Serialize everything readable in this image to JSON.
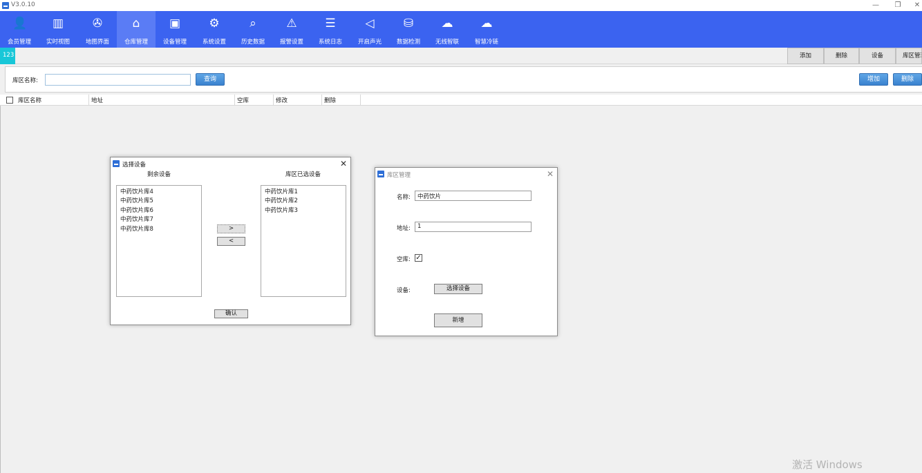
{
  "window": {
    "title": "V3.0.10",
    "minimize_glyph": "—",
    "restore_glyph": "❐",
    "close_glyph": "✕"
  },
  "toolbar": {
    "items": [
      {
        "label": "会员管理",
        "icon": "member-icon",
        "glyph": "👤"
      },
      {
        "label": "实时视图",
        "icon": "bars-icon",
        "glyph": "▥"
      },
      {
        "label": "地图界面",
        "icon": "map-icon",
        "glyph": "✇"
      },
      {
        "label": "仓库管理",
        "icon": "warehouse-icon",
        "glyph": "⌂",
        "active": true
      },
      {
        "label": "设备管理",
        "icon": "device-icon",
        "glyph": "▣"
      },
      {
        "label": "系统设置",
        "icon": "gear-icon",
        "glyph": "⚙"
      },
      {
        "label": "历史数据",
        "icon": "history-search-icon",
        "glyph": "⌕"
      },
      {
        "label": "报警设置",
        "icon": "alarm-icon",
        "glyph": "⚠"
      },
      {
        "label": "系统日志",
        "icon": "list-icon",
        "glyph": "☰"
      },
      {
        "label": "开启声光",
        "icon": "speaker-icon",
        "glyph": "◁"
      },
      {
        "label": "数据检测",
        "icon": "database-icon",
        "glyph": "⛁"
      },
      {
        "label": "无线智联",
        "icon": "cloud-icon",
        "glyph": "☁"
      },
      {
        "label": "智慧冷链",
        "icon": "cloud-icon",
        "glyph": "☁"
      }
    ]
  },
  "tabs": {
    "active_label": "123"
  },
  "top_buttons": [
    "添加",
    "删除",
    "设备",
    "库区管理"
  ],
  "search": {
    "label": "库区名称:",
    "value": "",
    "query_button": "查询"
  },
  "actions": {
    "add": "增加",
    "delete": "删除"
  },
  "table": {
    "headers": [
      "库区名称",
      "地址",
      "空库",
      "修改",
      "删除"
    ]
  },
  "select_dialog": {
    "title": "选择设备",
    "left_heading": "剩余设备",
    "right_heading": "库区已选设备",
    "remaining": [
      "中药饮片库4",
      "中药饮片库5",
      "中药饮片库6",
      "中药饮片库7",
      "中药饮片库8"
    ],
    "selected": [
      "中药饮片库1",
      "中药饮片库2",
      "中药饮片库3"
    ],
    "move_right": ">",
    "move_left": "<",
    "confirm": "确认"
  },
  "zone_dialog": {
    "title": "库区管理",
    "name_label": "名称:",
    "name_value": "中药饮片",
    "address_label": "地址:",
    "address_value": "1",
    "empty_label": "空库:",
    "empty_checked": true,
    "device_label": "设备:",
    "select_device_button": "选择设备",
    "new_button": "新增"
  },
  "watermark": "激活 Windows",
  "colors": {
    "toolbar": "#3b63f0",
    "active_tab": "#18c7d8",
    "query_button": "#3a82cf"
  }
}
